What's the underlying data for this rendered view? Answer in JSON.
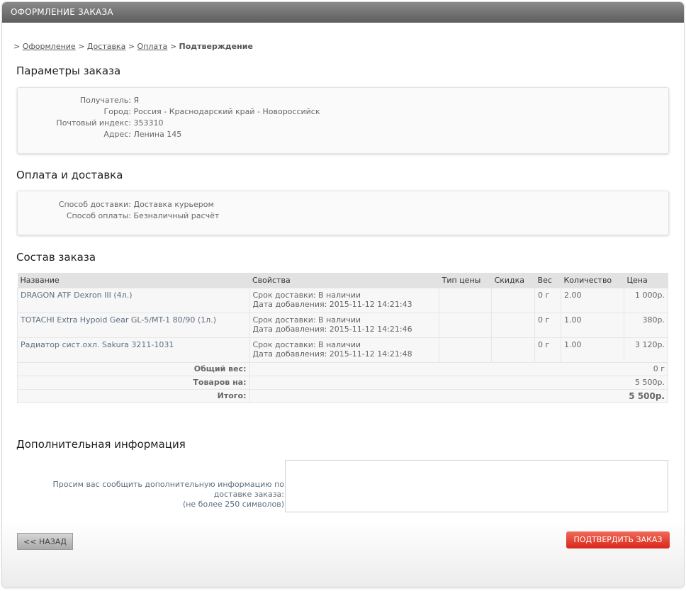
{
  "header": {
    "title": "ОФОРМЛЕНИЕ ЗАКАЗА"
  },
  "breadcrumb": {
    "prefix": ">",
    "steps": [
      "Оформление",
      "Доставка",
      "Оплата"
    ],
    "separator": ">",
    "current": "Подтверждение"
  },
  "params": {
    "title": "Параметры заказа",
    "rows": [
      {
        "label": "Получатель:",
        "value": "Я"
      },
      {
        "label": "Город:",
        "value": "Россия - Краснодарский край - Новороссийск"
      },
      {
        "label": "Почтовый индекс:",
        "value": "353310"
      },
      {
        "label": "Адрес:",
        "value": "Ленина 145"
      }
    ]
  },
  "payment": {
    "title": "Оплата и доставка",
    "rows": [
      {
        "label": "Способ доставки:",
        "value": "Доставка курьером"
      },
      {
        "label": "Способ оплаты:",
        "value": "Безналичный расчёт"
      }
    ]
  },
  "order": {
    "title": "Состав заказа",
    "columns": [
      "Название",
      "Свойства",
      "Тип цены",
      "Скидка",
      "Вес",
      "Количество",
      "Цена"
    ],
    "items": [
      {
        "name": "DRAGON ATF Dexron III (4л.)",
        "prop1": "Срок доставки: В наличии",
        "prop2": "Дата добавления: 2015-11-12 14:21:43",
        "price_type": "",
        "discount": "",
        "weight": "0 г",
        "qty": "2.00",
        "price": "1 000р."
      },
      {
        "name": "TOTACHI Extra Hypoid Gear GL-5/MT-1 80/90 (1л.)",
        "prop1": "Срок доставки: В наличии",
        "prop2": "Дата добавления: 2015-11-12 14:21:46",
        "price_type": "",
        "discount": "",
        "weight": "0 г",
        "qty": "1.00",
        "price": "380р."
      },
      {
        "name": "Радиатор сист.охл. Sakura 3211-1031",
        "prop1": "Срок доставки: В наличии",
        "prop2": "Дата добавления: 2015-11-12 14:21:48",
        "price_type": "",
        "discount": "",
        "weight": "0 г",
        "qty": "1.00",
        "price": "3 120р."
      }
    ],
    "summary": [
      {
        "label": "Общий вес:",
        "value": "0 г"
      },
      {
        "label": "Товаров на:",
        "value": "5 500р."
      },
      {
        "label": "Итого:",
        "value": "5 500р."
      }
    ]
  },
  "extra": {
    "title": "Дополнительная информация",
    "label_line1": "Просим вас сообщить дополнительную информацию по доставке заказа:",
    "label_line2": "(не более 250 символов)",
    "value": ""
  },
  "buttons": {
    "back": "<< НАЗАД",
    "confirm": "ПОДТВЕРДИТЬ ЗАКАЗ"
  }
}
